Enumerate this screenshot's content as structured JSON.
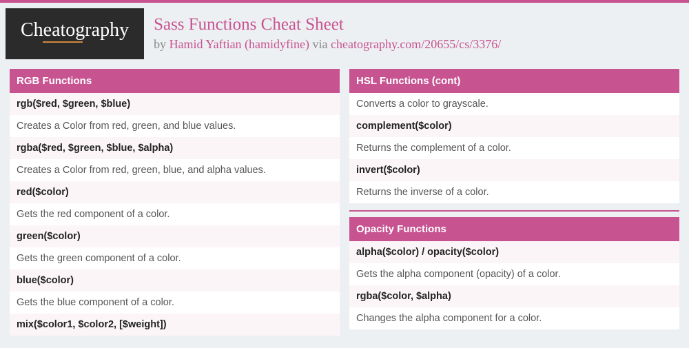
{
  "brand": "Cheatography",
  "title": "Sass Functions Cheat Sheet",
  "byline": {
    "prefix": "by ",
    "author": "Hamid Yaftian (hamidyfine)",
    "via": " via ",
    "url": "cheatography.com/20655/cs/3376/"
  },
  "columns": [
    {
      "sections": [
        {
          "header": "RGB Functions",
          "rows": [
            {
              "type": "fn",
              "text": "rgb($red, $green, $blue)"
            },
            {
              "type": "desc",
              "text": "Creates a Color from red, green, and blue values."
            },
            {
              "type": "fn",
              "text": "rgba($red, $green, $blue, $alpha)"
            },
            {
              "type": "desc",
              "text": "Creates a Color from red, green, blue, and alpha values."
            },
            {
              "type": "fn",
              "text": "red($color)"
            },
            {
              "type": "desc",
              "text": "Gets the red component of a color."
            },
            {
              "type": "fn",
              "text": "green($color)"
            },
            {
              "type": "desc",
              "text": "Gets the green component of a color."
            },
            {
              "type": "fn",
              "text": "blue($color)"
            },
            {
              "type": "desc",
              "text": "Gets the blue component of a color."
            },
            {
              "type": "fn",
              "text": "mix($color1, $color2, [$weight])"
            }
          ]
        }
      ]
    },
    {
      "sections": [
        {
          "header": "HSL Functions (cont)",
          "rows": [
            {
              "type": "desc",
              "text": "Converts a color to grayscale."
            },
            {
              "type": "fn",
              "text": "complement($color)"
            },
            {
              "type": "desc",
              "text": "Returns the complement of a color."
            },
            {
              "type": "fn",
              "text": "invert($color)"
            },
            {
              "type": "desc",
              "text": "Returns the inverse of a color."
            }
          ],
          "divider_after": true
        },
        {
          "header": "Opacity Functions",
          "rows": [
            {
              "type": "fn",
              "text": "alpha($color) / opacity($color)"
            },
            {
              "type": "desc",
              "text": "Gets the alpha component (opacity) of a color."
            },
            {
              "type": "fn",
              "text": "rgba($color, $alpha)"
            },
            {
              "type": "desc",
              "text": "Changes the alpha component for a color."
            }
          ]
        }
      ]
    }
  ]
}
